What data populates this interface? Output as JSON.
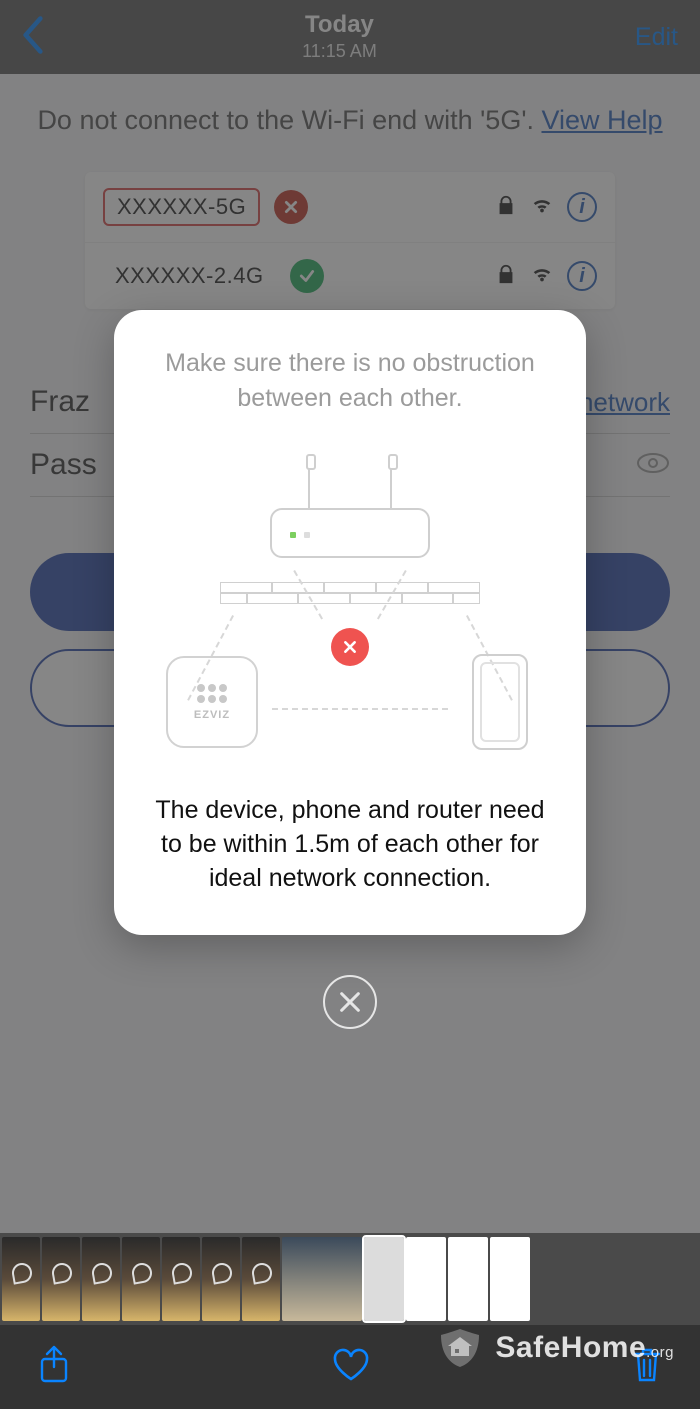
{
  "nav": {
    "title": "Today",
    "subtitle": "11:15 AM",
    "edit": "Edit"
  },
  "app": {
    "hint_prefix": "Do not connect to the Wi-Fi end with '5G'. ",
    "hint_link": "View Help",
    "wifi": {
      "bad_ssid": "XXXXXX-5G",
      "ok_ssid": "XXXXXX-2.4G"
    },
    "network_field": "Fraz",
    "network_link": "network",
    "password_field": "Pass"
  },
  "modal": {
    "top_text": "Make sure there is no obstruction between each other.",
    "brand": "EZVIZ",
    "bottom_text": "The device, phone and router need to be within 1.5m of each other for ideal network connection."
  },
  "watermark": {
    "name": "SafeHome",
    "suffix": ".org"
  }
}
